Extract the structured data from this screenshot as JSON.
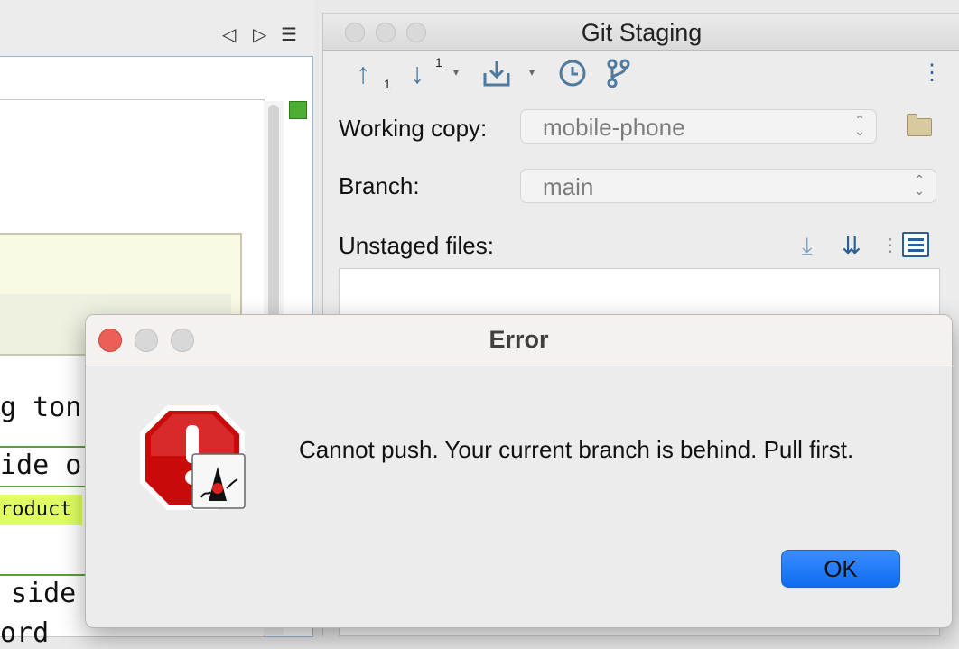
{
  "editor": {
    "nav_back": "◁",
    "nav_forward": "▷",
    "nav_menu": "☰",
    "code_lines": [
      "g ton",
      "ide o",
      "roduct",
      "side",
      "ord"
    ],
    "highlight_color": "#dfff62"
  },
  "git_staging": {
    "title": "Git Staging",
    "toolbar": {
      "push_count": "1",
      "pull_count": "1"
    },
    "working_copy_label": "Working copy:",
    "working_copy_value": "mobile-phone",
    "branch_label": "Branch:",
    "branch_value": "main",
    "unstaged_label": "Unstaged files:"
  },
  "dialog": {
    "title": "Error",
    "message": "Cannot push. Your current branch is behind. Pull first.",
    "ok_label": "OK",
    "close_color": "#ec5f57",
    "ok_color": "#0f6cf0"
  }
}
